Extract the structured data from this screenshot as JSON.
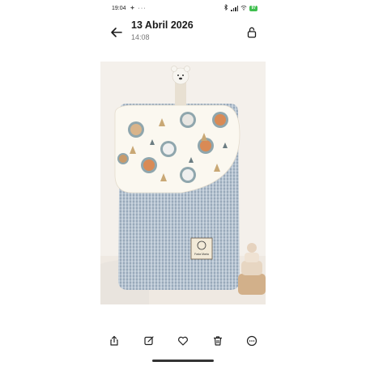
{
  "status_bar": {
    "time": "19:04",
    "battery": "97"
  },
  "header": {
    "title": "13 Abril 2026",
    "subtitle": "14:08"
  },
  "photo": {
    "badge_text": "Fada Maria"
  },
  "icons": {
    "back": "arrow-left-icon",
    "lock": "lock-icon",
    "share": "share-icon",
    "edit": "edit-icon",
    "favorite": "heart-icon",
    "delete": "trash-icon",
    "more": "more-icon"
  }
}
